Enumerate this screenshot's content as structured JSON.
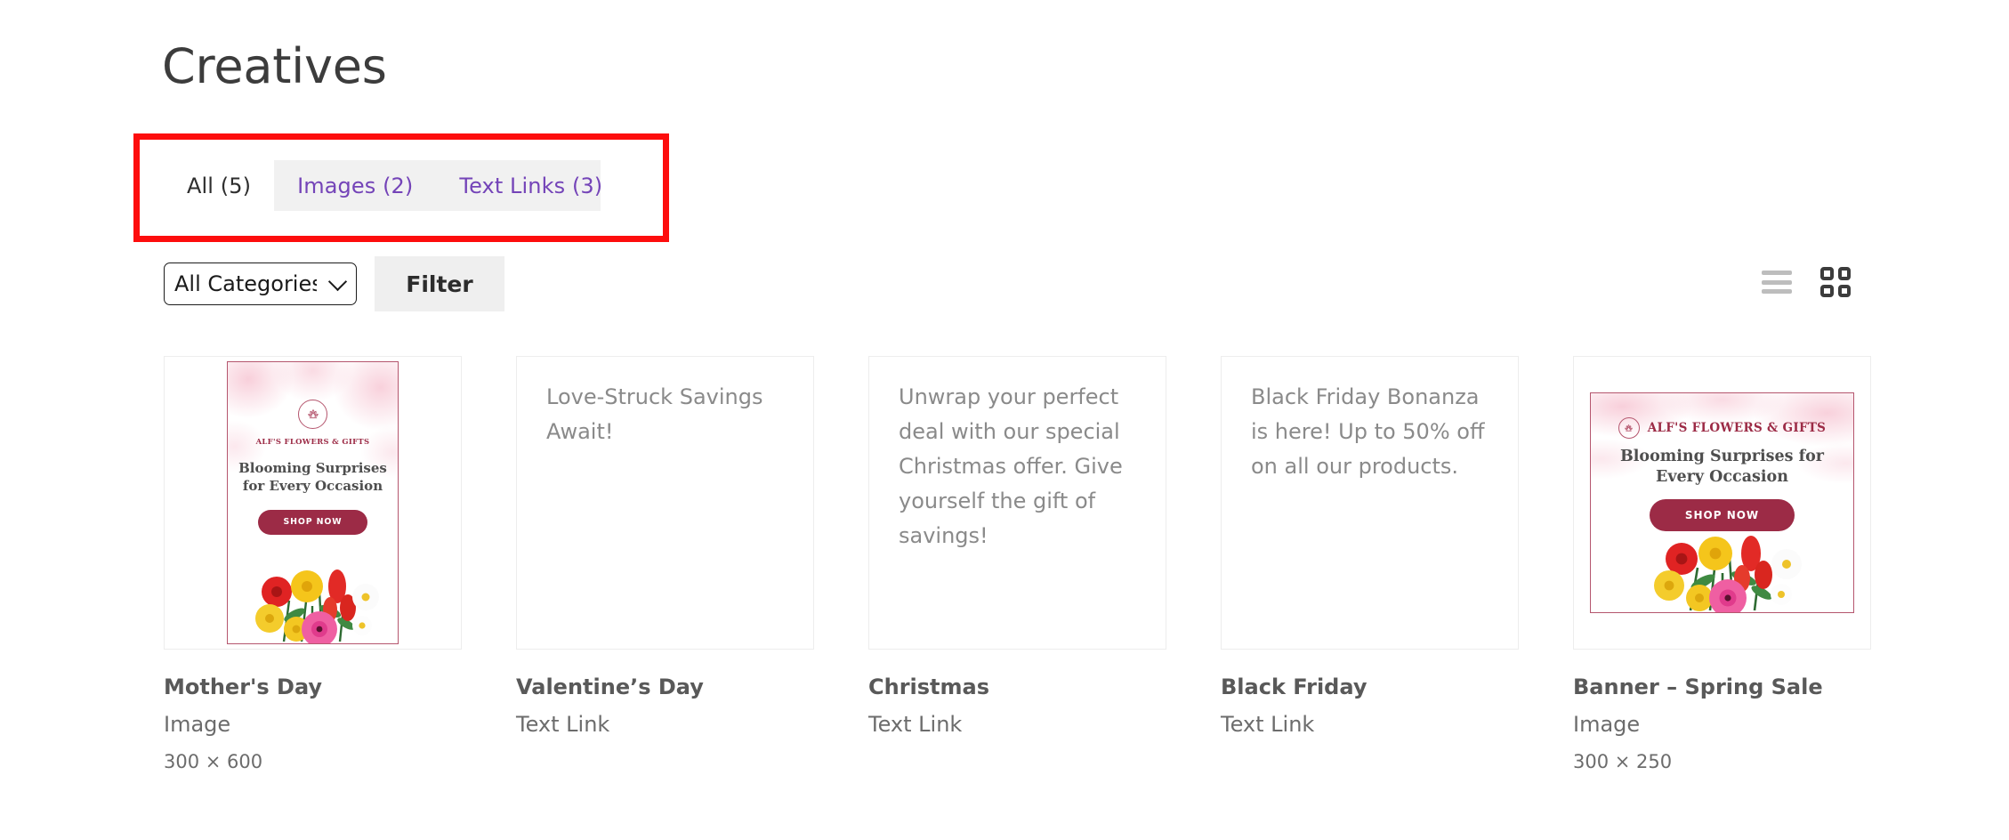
{
  "page": {
    "title": "Creatives"
  },
  "tabs": [
    {
      "label": "All (5)",
      "active": true
    },
    {
      "label": "Images (2)",
      "active": false
    },
    {
      "label": "Text Links (3)",
      "active": false
    }
  ],
  "filters": {
    "category_select": {
      "value": "All Categories",
      "options": [
        "All Categories"
      ]
    },
    "filter_button": "Filter"
  },
  "view_toggle": {
    "list_label": "list-view",
    "grid_label": "grid-view",
    "active": "grid"
  },
  "creative_artwork": {
    "brand": "ALF'S FLOWERS & GIFTS",
    "headline_vertical": "Blooming Surprises for Every Occasion",
    "headline_horizontal": "Blooming Surprises for Every Occasion",
    "cta": "SHOP NOW"
  },
  "cards": [
    {
      "name": "Mother's Day",
      "type": "Image",
      "dimensions": "300 × 600",
      "media_kind": "banner-vertical",
      "text": ""
    },
    {
      "name": "Valentine’s Day",
      "type": "Text Link",
      "dimensions": "",
      "media_kind": "text",
      "text": "Love-Struck Savings Await!"
    },
    {
      "name": "Christmas",
      "type": "Text Link",
      "dimensions": "",
      "media_kind": "text",
      "text": "Unwrap your perfect deal with our special Christmas offer. Give yourself the gift of savings!"
    },
    {
      "name": "Black Friday",
      "type": "Text Link",
      "dimensions": "",
      "media_kind": "text",
      "text": "Black Friday Bonanza is here! Up to 50% off on all our products."
    },
    {
      "name": "Banner – Spring Sale",
      "type": "Image",
      "dimensions": "300 × 250",
      "media_kind": "banner-horizontal",
      "text": ""
    }
  ],
  "colors": {
    "tab_link": "#7444b8",
    "tab_bar_bg": "#f1f1f1",
    "annotation": "#fd0d0d",
    "brand_maroon": "#9c2b46",
    "card_border": "#ededed",
    "filter_button_bg": "#efefef"
  }
}
